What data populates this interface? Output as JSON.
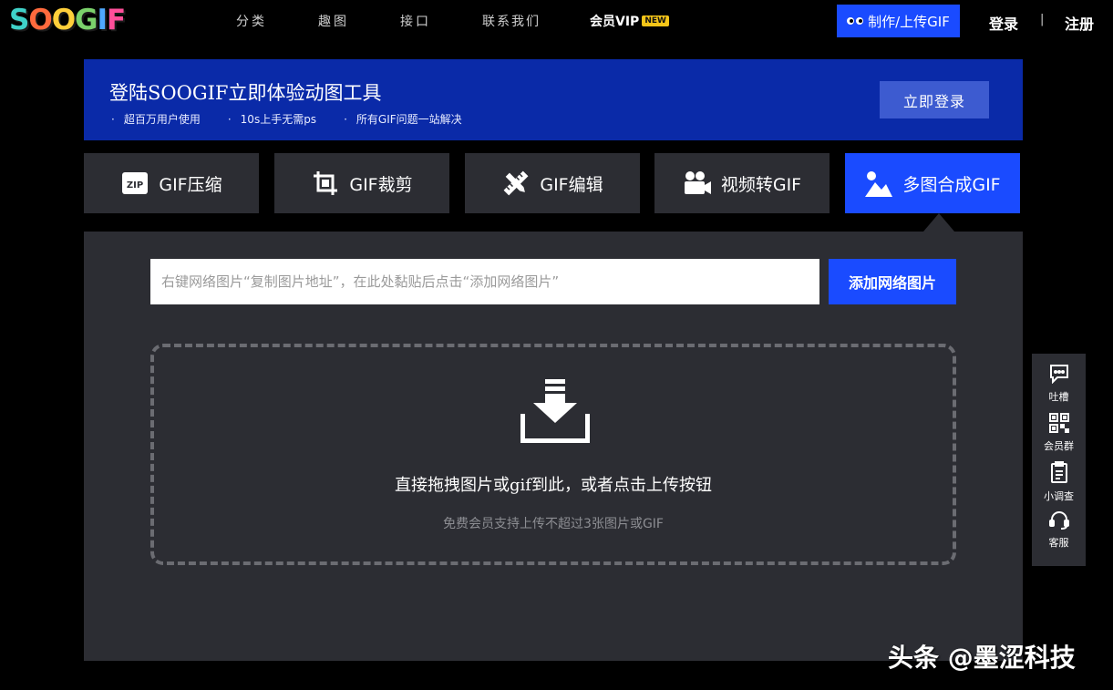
{
  "logo": {
    "text": "SOOGIF",
    "letters": [
      "S",
      "O",
      "O",
      "G",
      "I",
      "F"
    ],
    "colors": [
      "#3fd1c8",
      "#ff6a3d",
      "#ffcf3a",
      "#7bd26b",
      "#4fa8ff",
      "#ff4f9a"
    ]
  },
  "nav": {
    "items": [
      "分类",
      "趣图",
      "接口",
      "联系我们"
    ],
    "vip_label": "会员VIP",
    "vip_badge": "NEW",
    "make_button": "制作/上传GIF",
    "login": "登录",
    "separator": "|",
    "register": "注册"
  },
  "banner": {
    "title": "登陆SOOGIF立即体验动图工具",
    "points": [
      "超百万用户使用",
      "10s上手无需ps",
      "所有GIF问题一站解决"
    ],
    "button": "立即登录"
  },
  "tools": [
    {
      "label": "GIF压缩",
      "icon": "zip-icon",
      "active": false
    },
    {
      "label": "GIF裁剪",
      "icon": "crop-icon",
      "active": false
    },
    {
      "label": "GIF编辑",
      "icon": "pencil-ruler-icon",
      "active": false
    },
    {
      "label": "视频转GIF",
      "icon": "video-camera-icon",
      "active": false
    },
    {
      "label": "多图合成GIF",
      "icon": "image-icon",
      "active": true
    }
  ],
  "upload": {
    "url_placeholder": "右键网络图片“复制图片地址”，在此处黏贴后点击“添加网络图片”",
    "add_button": "添加网络图片",
    "drop_text": "直接拖拽图片或gif到此，或者点击上传按钮",
    "drop_sub": "免费会员支持上传不超过3张图片或GIF"
  },
  "float_bar": {
    "items": [
      {
        "label": "吐槽",
        "icon": "chat-bubble-icon"
      },
      {
        "label": "会员群",
        "icon": "qr-code-icon"
      },
      {
        "label": "小调查",
        "icon": "clipboard-icon"
      },
      {
        "label": "客服",
        "icon": "headset-icon"
      }
    ]
  },
  "watermark": "头条 @墨涩科技",
  "colors": {
    "accent": "#1a4bff",
    "banner": "#0a2aa8",
    "panel": "#2c2d33",
    "background": "#000000"
  }
}
